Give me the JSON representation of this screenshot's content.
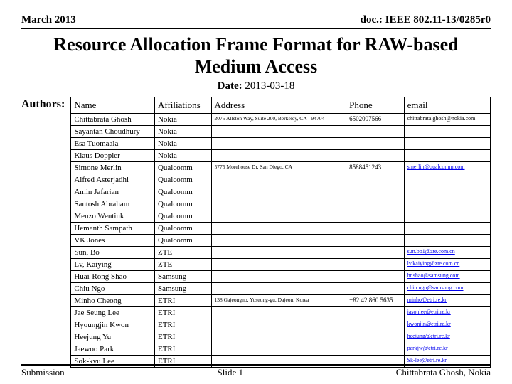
{
  "header": {
    "left": "March 2013",
    "right": "doc.: IEEE 802.11-13/0285r0"
  },
  "title": "Resource Allocation Frame Format for RAW-based Medium Access",
  "date_label": "Date:",
  "date_value": "2013-03-18",
  "authors_label": "Authors:",
  "cols": {
    "c0": "Name",
    "c1": "Affiliations",
    "c2": "Address",
    "c3": "Phone",
    "c4": "email"
  },
  "rows": [
    {
      "name": "Chittabrata Ghosh",
      "aff": "Nokia",
      "addr": "2075 Allston Way, Suite 200, Berkeley, CA - 94704",
      "phone": "6502007566",
      "email": "chittabrata.ghosh@nokia.com",
      "link": false
    },
    {
      "name": "Sayantan Choudhury",
      "aff": "Nokia",
      "addr": "",
      "phone": "",
      "email": "",
      "link": false
    },
    {
      "name": "Esa Tuomaala",
      "aff": "Nokia",
      "addr": "",
      "phone": "",
      "email": "",
      "link": false
    },
    {
      "name": "Klaus Doppler",
      "aff": "Nokia",
      "addr": "",
      "phone": "",
      "email": "",
      "link": false
    },
    {
      "name": "Simone Merlin",
      "aff": "Qualcomm",
      "addr": "5775 Morehouse Dr, San Diego, CA",
      "phone": "8588451243",
      "email": "smerlin@qualcomm.com",
      "link": true
    },
    {
      "name": "Alfred Asterjadhi",
      "aff": "Qualcomm",
      "addr": "",
      "phone": "",
      "email": "",
      "link": false
    },
    {
      "name": "Amin Jafarian",
      "aff": "Qualcomm",
      "addr": "",
      "phone": "",
      "email": "",
      "link": false
    },
    {
      "name": "Santosh Abraham",
      "aff": "Qualcomm",
      "addr": "",
      "phone": "",
      "email": "",
      "link": false
    },
    {
      "name": "Menzo Wentink",
      "aff": "Qualcomm",
      "addr": "",
      "phone": "",
      "email": "",
      "link": false
    },
    {
      "name": "Hemanth Sampath",
      "aff": "Qualcomm",
      "addr": "",
      "phone": "",
      "email": "",
      "link": false
    },
    {
      "name": "VK Jones",
      "aff": "Qualcomm",
      "addr": "",
      "phone": "",
      "email": "",
      "link": false
    },
    {
      "name": "Sun, Bo",
      "aff": "ZTE",
      "addr": "",
      "phone": "",
      "email": "sun.bo1@zte.com.cn",
      "link": true
    },
    {
      "name": "Lv, Kaiying",
      "aff": "ZTE",
      "addr": "",
      "phone": "",
      "email": "lv.kaiying@zte.com.cn",
      "link": true
    },
    {
      "name": "Huai-Rong Shao",
      "aff": "Samsung",
      "addr": "",
      "phone": "",
      "email": "hr.shao@samsung.com",
      "link": true
    },
    {
      "name": "Chiu Ngo",
      "aff": "Samsung",
      "addr": "",
      "phone": "",
      "email": "chiu.ngo@samsung.com",
      "link": true
    },
    {
      "name": "Minho Cheong",
      "aff": "ETRI",
      "addr": "138 Gajeongno, Yuseong-gu, Dajeon, Korea",
      "phone": "+82 42 860 5635",
      "email": "minho@etri.re.kr",
      "link": true
    },
    {
      "name": "Jae Seung Lee",
      "aff": "ETRI",
      "addr": "",
      "phone": "",
      "email": "jasonlee@etri.re.kr",
      "link": true
    },
    {
      "name": "Hyoungjin Kwon",
      "aff": "ETRI",
      "addr": "",
      "phone": "",
      "email": "kwonjin@etri.re.kr",
      "link": true
    },
    {
      "name": "Heejung Yu",
      "aff": "ETRI",
      "addr": "",
      "phone": "",
      "email": "heejung@etri.re.kr",
      "link": true
    },
    {
      "name": "Jaewoo Park",
      "aff": "ETRI",
      "addr": "",
      "phone": "",
      "email": "parkjw@etri.re.kr",
      "link": true
    },
    {
      "name": "Sok-kyu Lee",
      "aff": "ETRI",
      "addr": "",
      "phone": "",
      "email": "Sk-lee@etri.re.kr",
      "link": true
    }
  ],
  "footer": {
    "left": "Submission",
    "center": "Slide 1",
    "right": "Chittabrata Ghosh, Nokia"
  }
}
